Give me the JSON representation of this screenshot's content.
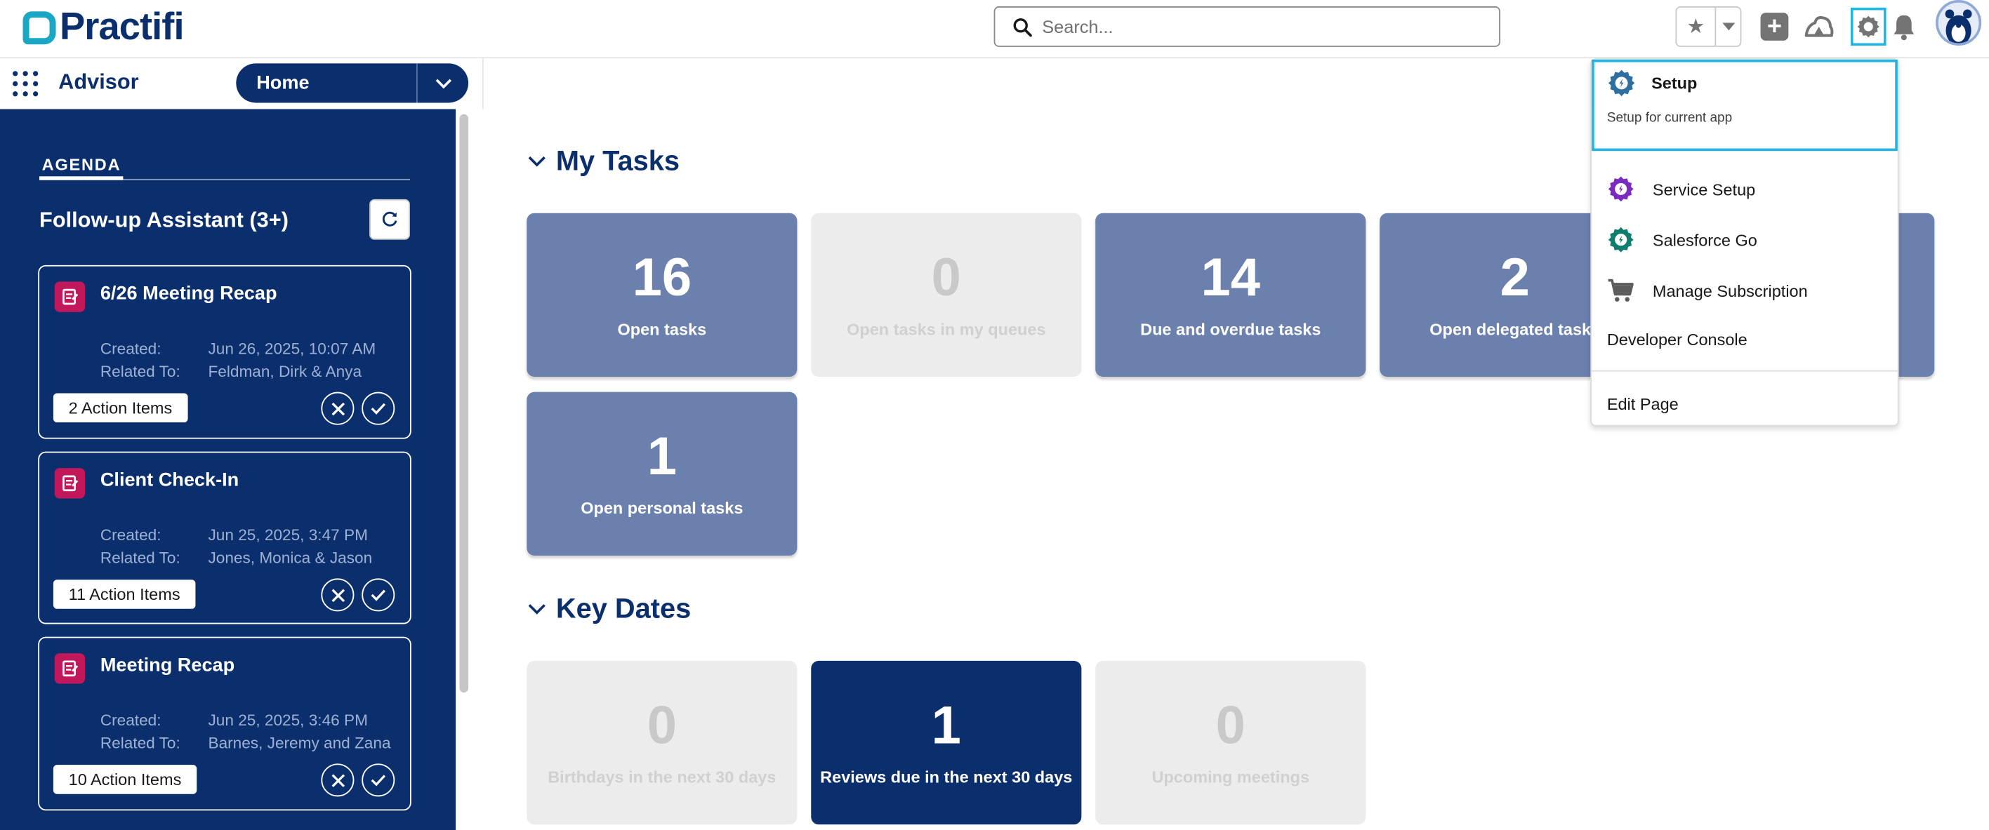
{
  "header": {
    "logo_text": "Practifi",
    "search_placeholder": "Search...",
    "icons": [
      "favorites-star-icon",
      "favorites-dropdown-icon",
      "global-add-icon",
      "trailhead-icon",
      "setup-gear-icon",
      "notifications-bell-icon",
      "user-avatar"
    ]
  },
  "nav": {
    "app_name": "Advisor",
    "current_tab": "Home"
  },
  "sidebar": {
    "agenda_tab": "AGENDA",
    "section_title": "Follow-up Assistant (3+)",
    "cards": [
      {
        "title": "6/26 Meeting Recap",
        "created_label": "Created:",
        "created": "Jun 26, 2025, 10:07 AM",
        "related_label": "Related To:",
        "related": "Feldman, Dirk & Anya",
        "action_items": "2 Action Items"
      },
      {
        "title": "Client Check-In",
        "created_label": "Created:",
        "created": "Jun 25, 2025, 3:47 PM",
        "related_label": "Related To:",
        "related": "Jones, Monica & Jason",
        "action_items": "11 Action Items"
      },
      {
        "title": "Meeting Recap",
        "created_label": "Created:",
        "created": "Jun 25, 2025, 3:46 PM",
        "related_label": "Related To:",
        "related": "Barnes, Jeremy and Zana",
        "action_items": "10 Action Items"
      }
    ]
  },
  "main": {
    "my_tasks": {
      "title": "My Tasks",
      "tiles": [
        {
          "value": "16",
          "label": "Open tasks"
        },
        {
          "value": "0",
          "label": "Open tasks in my queues"
        },
        {
          "value": "14",
          "label": "Due and overdue tasks"
        },
        {
          "value": "2",
          "label": "Open delegated tasks"
        },
        {
          "value": "1",
          "label": "Open personal tasks"
        }
      ]
    },
    "key_dates": {
      "title": "Key Dates",
      "tiles": [
        {
          "value": "0",
          "label": "Birthdays in the next 30 days"
        },
        {
          "value": "1",
          "label": "Reviews due in the next 30 days"
        },
        {
          "value": "0",
          "label": "Upcoming meetings"
        }
      ]
    }
  },
  "setup_menu": {
    "setup_title": "Setup",
    "setup_subtitle": "Setup for current app",
    "items": [
      "Service Setup",
      "Salesforce Go",
      "Manage Subscription",
      "Developer Console",
      "Edit Page"
    ]
  },
  "colors": {
    "navy": "#0b2f6d",
    "tile_mid": "#6b80ad",
    "tile_empty": "#ececec",
    "accent_cyan": "#1fb6e5",
    "logo_teal": "#1aa7c4",
    "card_icon": "#c2185b"
  }
}
